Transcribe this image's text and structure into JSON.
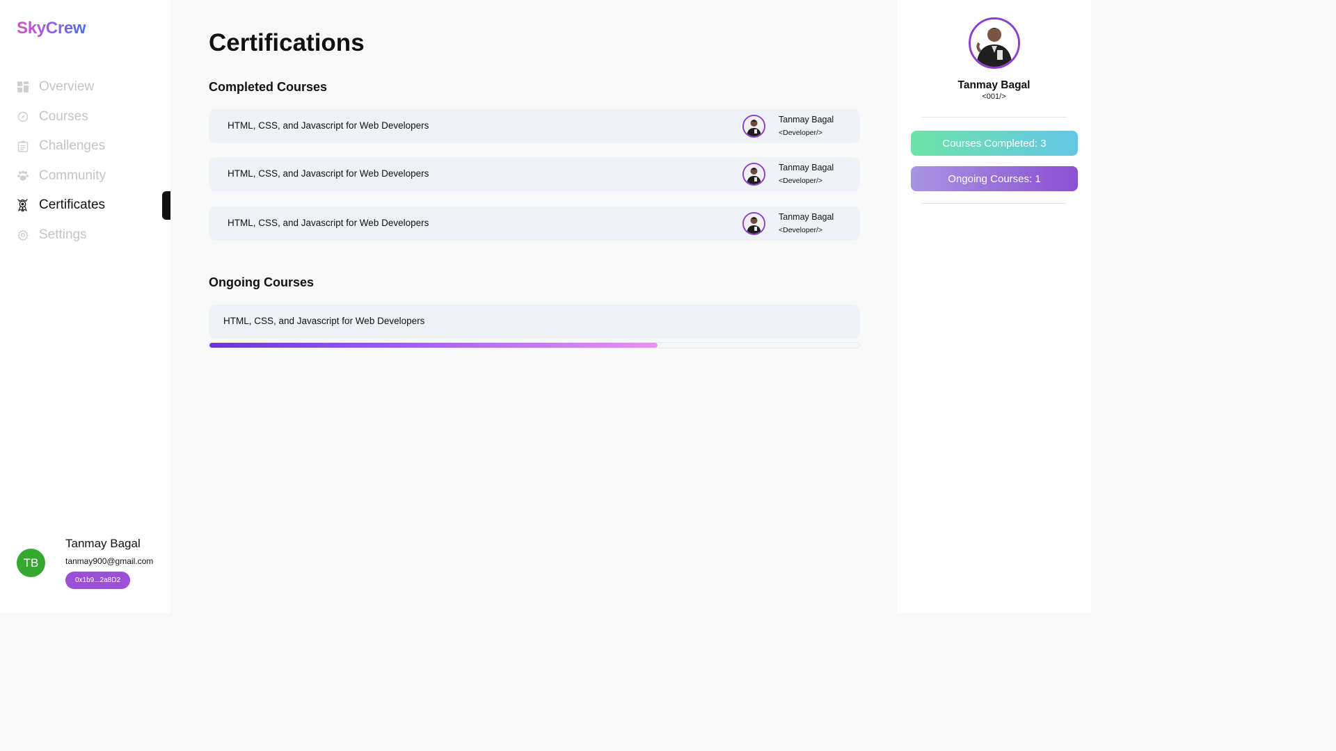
{
  "app": {
    "logo": "SkyCrew"
  },
  "sidebar": {
    "items": [
      {
        "label": "Overview",
        "icon": "grid-icon",
        "active": false
      },
      {
        "label": "Courses",
        "icon": "compass-icon",
        "active": false
      },
      {
        "label": "Challenges",
        "icon": "clipboard-icon",
        "active": false
      },
      {
        "label": "Community",
        "icon": "paw-icon",
        "active": false
      },
      {
        "label": "Certificates",
        "icon": "certificate-icon",
        "active": true
      },
      {
        "label": "Settings",
        "icon": "gear-icon",
        "active": false
      }
    ],
    "user": {
      "initials": "TB",
      "name": "Tanmay Bagal",
      "email": "tanmay900@gmail.com",
      "wallet": "0x1b9...2a8D2"
    }
  },
  "main": {
    "title": "Certifications",
    "completed": {
      "heading": "Completed Courses",
      "courses": [
        {
          "title": "HTML, CSS, and Javascript for Web Developers",
          "instructor": "Tanmay Bagal",
          "role": "<Developer/>"
        },
        {
          "title": "HTML, CSS, and Javascript for Web Developers",
          "instructor": "Tanmay Bagal",
          "role": "<Developer/>"
        },
        {
          "title": "HTML, CSS, and Javascript for Web Developers",
          "instructor": "Tanmay Bagal",
          "role": "<Developer/>"
        }
      ]
    },
    "ongoing": {
      "heading": "Ongoing Courses",
      "courses": [
        {
          "title": "HTML, CSS, and Javascript for Web Developers",
          "progress": 0.69
        }
      ]
    }
  },
  "profile": {
    "name": "Tanmay Bagal",
    "id": "<001/>",
    "completed_label": "Courses Completed: 3",
    "ongoing_label": "Ongoing Courses: 1"
  },
  "colors": {
    "accent": "#8a3fd1",
    "avatar_green": "#35a82f",
    "completed_gradient": [
      "#6de3a7",
      "#63c6e6"
    ],
    "ongoing_gradient": [
      "#a895e2",
      "#8b4fd2"
    ],
    "progress_gradient": [
      "#6a34e0",
      "#ec8ff6"
    ]
  }
}
